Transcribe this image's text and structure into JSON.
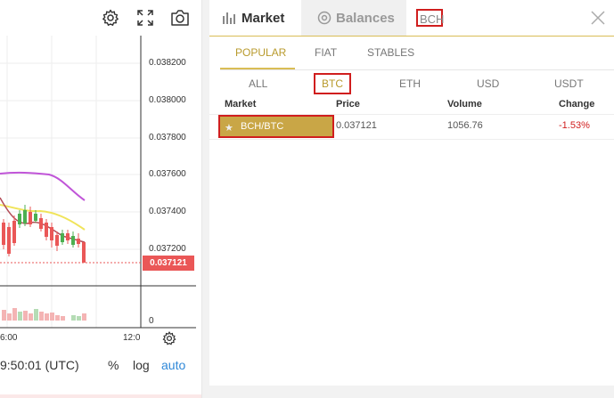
{
  "chart": {
    "price_axis": [
      "0.038200",
      "0.038000",
      "0.037800",
      "0.037600",
      "0.037400",
      "0.037200"
    ],
    "current_price": "0.037121",
    "volume_zero": "0",
    "time_labels": [
      "6:00",
      "12:0"
    ],
    "bottom_time": "9:50:01 (UTC)",
    "bottom_percent": "%",
    "bottom_log": "log",
    "bottom_auto": "auto",
    "colors": {
      "up": "#ea5757",
      "down": "#4caf50",
      "ma_slow": "#c055d8",
      "ma_fast": "#f0e45a",
      "ma_mid": "#b34b57"
    }
  },
  "panel": {
    "tabs": [
      {
        "label": "Market",
        "icon": "bar-chart-icon"
      },
      {
        "label": "Balances",
        "icon": "coin-icon"
      }
    ],
    "search_value": "BCH",
    "subtabs": [
      "POPULAR",
      "FIAT",
      "STABLES"
    ],
    "markets": [
      "ALL",
      "BTC",
      "ETH",
      "USD",
      "USDT"
    ],
    "columns": [
      "Market",
      "Price",
      "Volume",
      "Change"
    ],
    "rows": [
      {
        "market": "BCH/BTC",
        "price": "0.037121",
        "volume": "1056.76",
        "change": "-1.53%"
      }
    ],
    "accent": "#d9bd55",
    "negative": "#d01e1e"
  }
}
